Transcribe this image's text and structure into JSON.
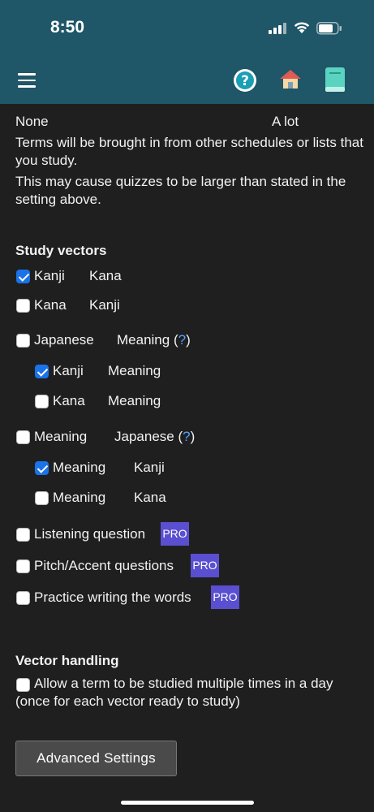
{
  "status": {
    "time": "8:50"
  },
  "slider": {
    "min_label": "None",
    "max_label": "A lot"
  },
  "notes": {
    "line1": "Terms will be brought in from other schedules or lists that you study.",
    "line2": "This may cause quizzes to be larger than stated in the setting above."
  },
  "study_vectors": {
    "heading": "Study vectors",
    "items": [
      {
        "from": "Kanji",
        "to": "Kana",
        "checked": true
      },
      {
        "from": "Kana",
        "to": "Kanji",
        "checked": false
      },
      {
        "from": "Japanese",
        "to": "Meaning",
        "checked": false,
        "help": "?"
      },
      {
        "from": "Kanji",
        "to": "Meaning",
        "checked": true
      },
      {
        "from": "Kana",
        "to": "Meaning",
        "checked": false
      },
      {
        "from": "Meaning",
        "to": "Japanese",
        "checked": false,
        "help": "?"
      },
      {
        "from": "Meaning",
        "to": "Kanji",
        "checked": true
      },
      {
        "from": "Meaning",
        "to": "Kana",
        "checked": false
      },
      {
        "label": "Listening question",
        "checked": false,
        "badge": "PRO"
      },
      {
        "label": "Pitch/Accent questions",
        "checked": false,
        "badge": "PRO"
      },
      {
        "label": "Practice writing the words",
        "checked": false,
        "badge": "PRO"
      }
    ]
  },
  "vector_handling": {
    "heading": "Vector handling",
    "option": "Allow a term to be studied multiple times in a day (once for each vector ready to study)",
    "checked": false
  },
  "advanced_button": "Advanced Settings",
  "icons": [
    "menu-icon",
    "help-icon",
    "home-icon",
    "book-icon"
  ]
}
